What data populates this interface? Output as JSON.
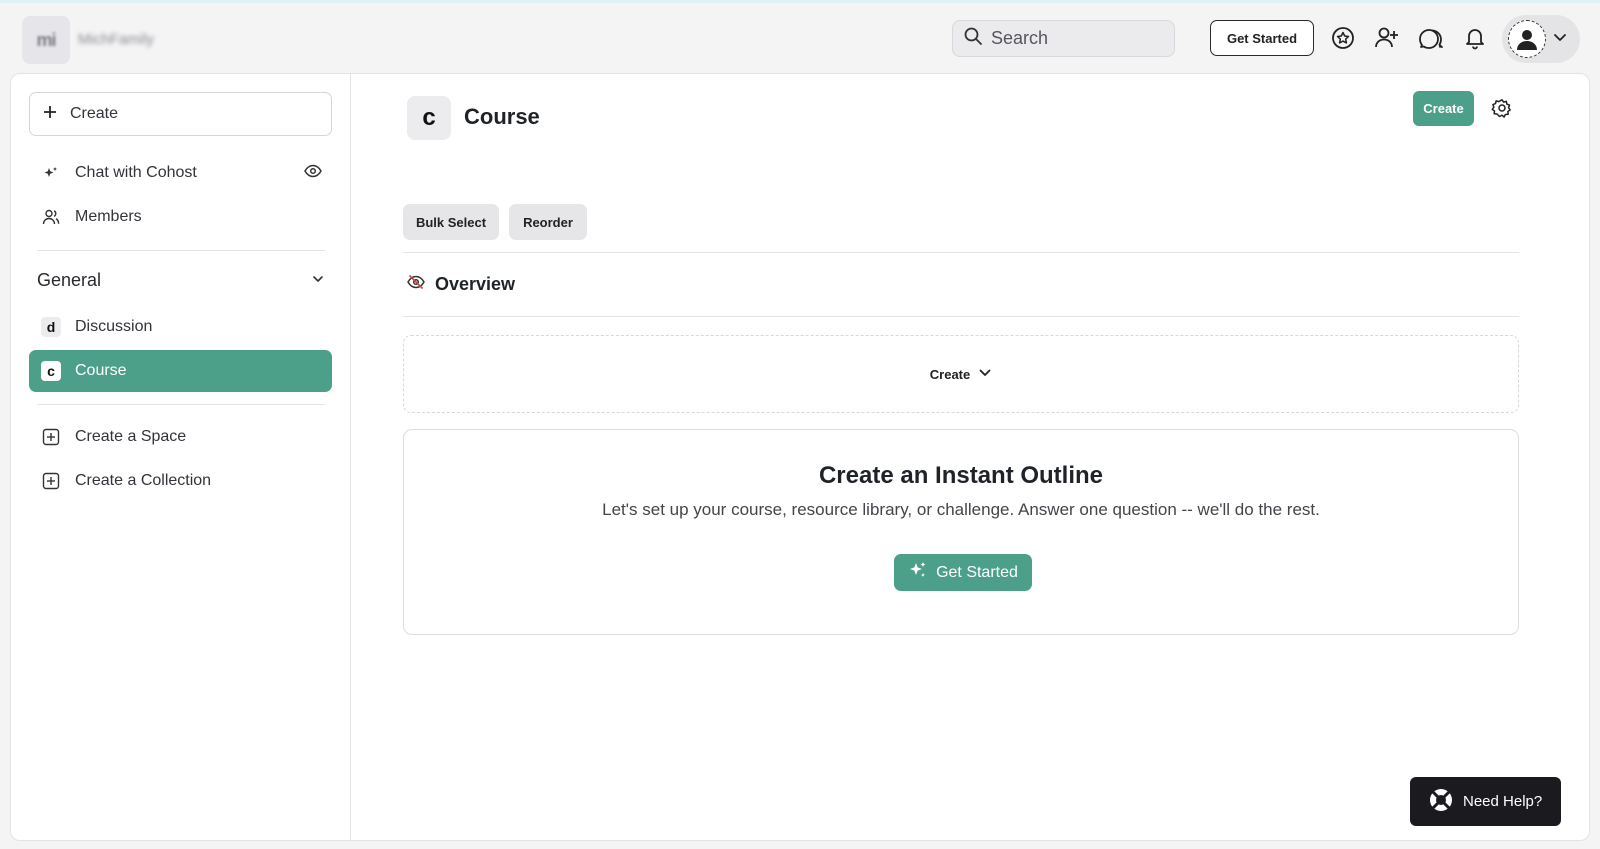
{
  "header": {
    "logo_text": "mi",
    "org_name": "MichFamily",
    "search_placeholder": "Search",
    "get_started_label": "Get Started"
  },
  "sidebar": {
    "create_label": "Create",
    "top_items": [
      {
        "label": "Chat with Cohost",
        "icon": "sparkle-icon"
      },
      {
        "label": "Members",
        "icon": "people-icon"
      }
    ],
    "section_title": "General",
    "spaces": [
      {
        "badge": "d",
        "label": "Discussion",
        "active": false
      },
      {
        "badge": "c",
        "label": "Course",
        "active": true
      }
    ],
    "bottom_items": [
      {
        "label": "Create a Space",
        "icon": "plus-square-icon"
      },
      {
        "label": "Create a Collection",
        "icon": "plus-square-icon"
      }
    ]
  },
  "content": {
    "badge": "c",
    "title": "Course",
    "create_label": "Create",
    "bulk_select_label": "Bulk Select",
    "reorder_label": "Reorder",
    "overview_label": "Overview",
    "create_dropdown_label": "Create",
    "outline": {
      "title": "Create an Instant Outline",
      "description": "Let's set up your course, resource library, or challenge. Answer one question -- we'll do the rest.",
      "button_label": "Get Started"
    }
  },
  "help": {
    "label": "Need Help?"
  },
  "colors": {
    "accent": "#4c9f89",
    "help_bg": "#1b1b1f"
  }
}
